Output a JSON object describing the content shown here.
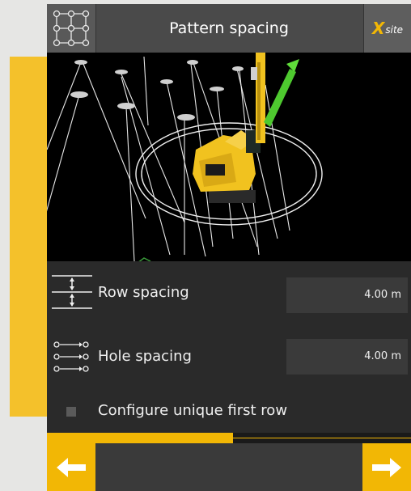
{
  "header": {
    "title": "Pattern spacing",
    "brand_x": "X",
    "brand_site": "site"
  },
  "fields": [
    {
      "label": "Row spacing",
      "value": "4.00 m",
      "icon": "row-spacing-icon"
    },
    {
      "label": "Hole spacing",
      "value": "4.00 m",
      "icon": "hole-spacing-icon"
    }
  ],
  "option": {
    "label": "Configure unique first row",
    "checked": false
  },
  "progress": 0.51,
  "nav": {
    "back_icon": "arrow-left-icon",
    "next_icon": "arrow-right-icon"
  },
  "colors": {
    "accent": "#f2b705",
    "background": "#262626",
    "header": "#4a4a4a"
  }
}
